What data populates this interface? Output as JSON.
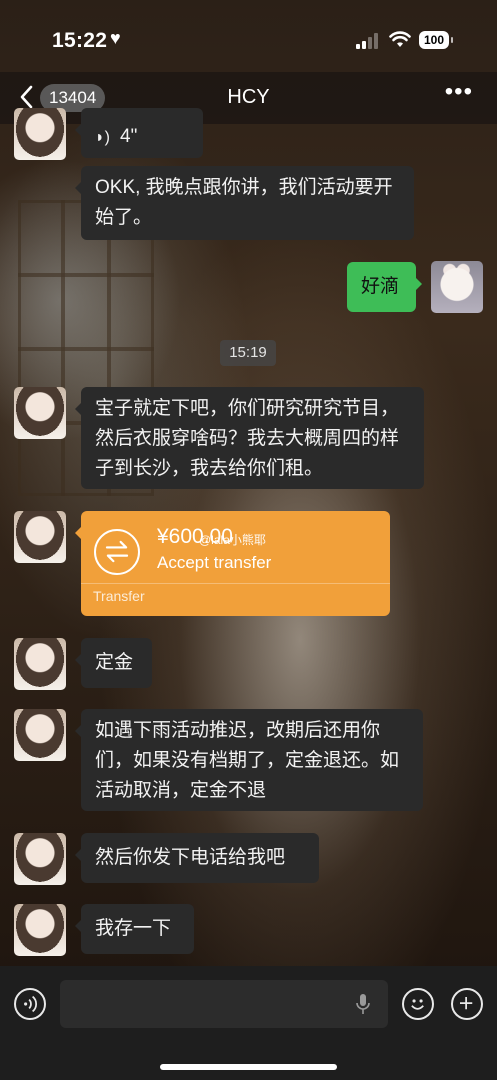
{
  "status_bar": {
    "time": "15:22",
    "battery": "100"
  },
  "nav": {
    "unread_count": "13404",
    "title": "HCY"
  },
  "messages": {
    "voice_duration": "4\"",
    "m1": "OKK, 我晚点跟你讲，我们活动要开始了。",
    "m2_me": "好滴",
    "timestamp": "15:19",
    "m3": "宝子就定下吧，你们研究研究节目，然后衣服穿啥码？我去大概周四的样子到长沙，我去给你们租。",
    "m5": "定金",
    "m6": "如遇下雨活动推迟，改期后还用你们，如果没有档期了，定金退还。如活动取消，定金不退",
    "m7": "然后你发下电话给我吧",
    "m8": "我存一下"
  },
  "transfer": {
    "amount": "¥600.00",
    "watermark": "@lala小熊耶",
    "status": "Accept transfer",
    "label": "Transfer"
  },
  "icons": {
    "back": "chevron-left-icon",
    "more": "more-dots-icon",
    "voice": "voice-icon",
    "transfer": "transfer-arrows-icon",
    "mic": "mic-icon",
    "emoji": "emoji-icon",
    "plus": "plus-icon"
  },
  "colors": {
    "my_bubble": "#3ebd57",
    "their_bubble": "#2a2a2a",
    "transfer_card": "#f1a03a"
  }
}
